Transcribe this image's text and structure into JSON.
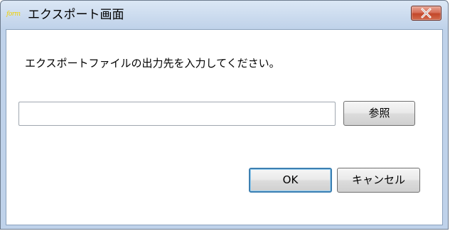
{
  "window": {
    "title": "エクスポート画面",
    "app_icon_text": "form",
    "close_icon": "close-x-icon"
  },
  "dialog": {
    "message": "エクスポートファイルの出力先を入力してください。",
    "path_input": {
      "value": "",
      "placeholder": ""
    },
    "browse_label": "参照",
    "ok_label": "OK",
    "cancel_label": "キャンセル"
  },
  "colors": {
    "titlebar": "#c6d7ec",
    "close_button": "#c2472a",
    "app_icon": "#f0d000",
    "ok_focus_border": "#3c7fb1"
  }
}
